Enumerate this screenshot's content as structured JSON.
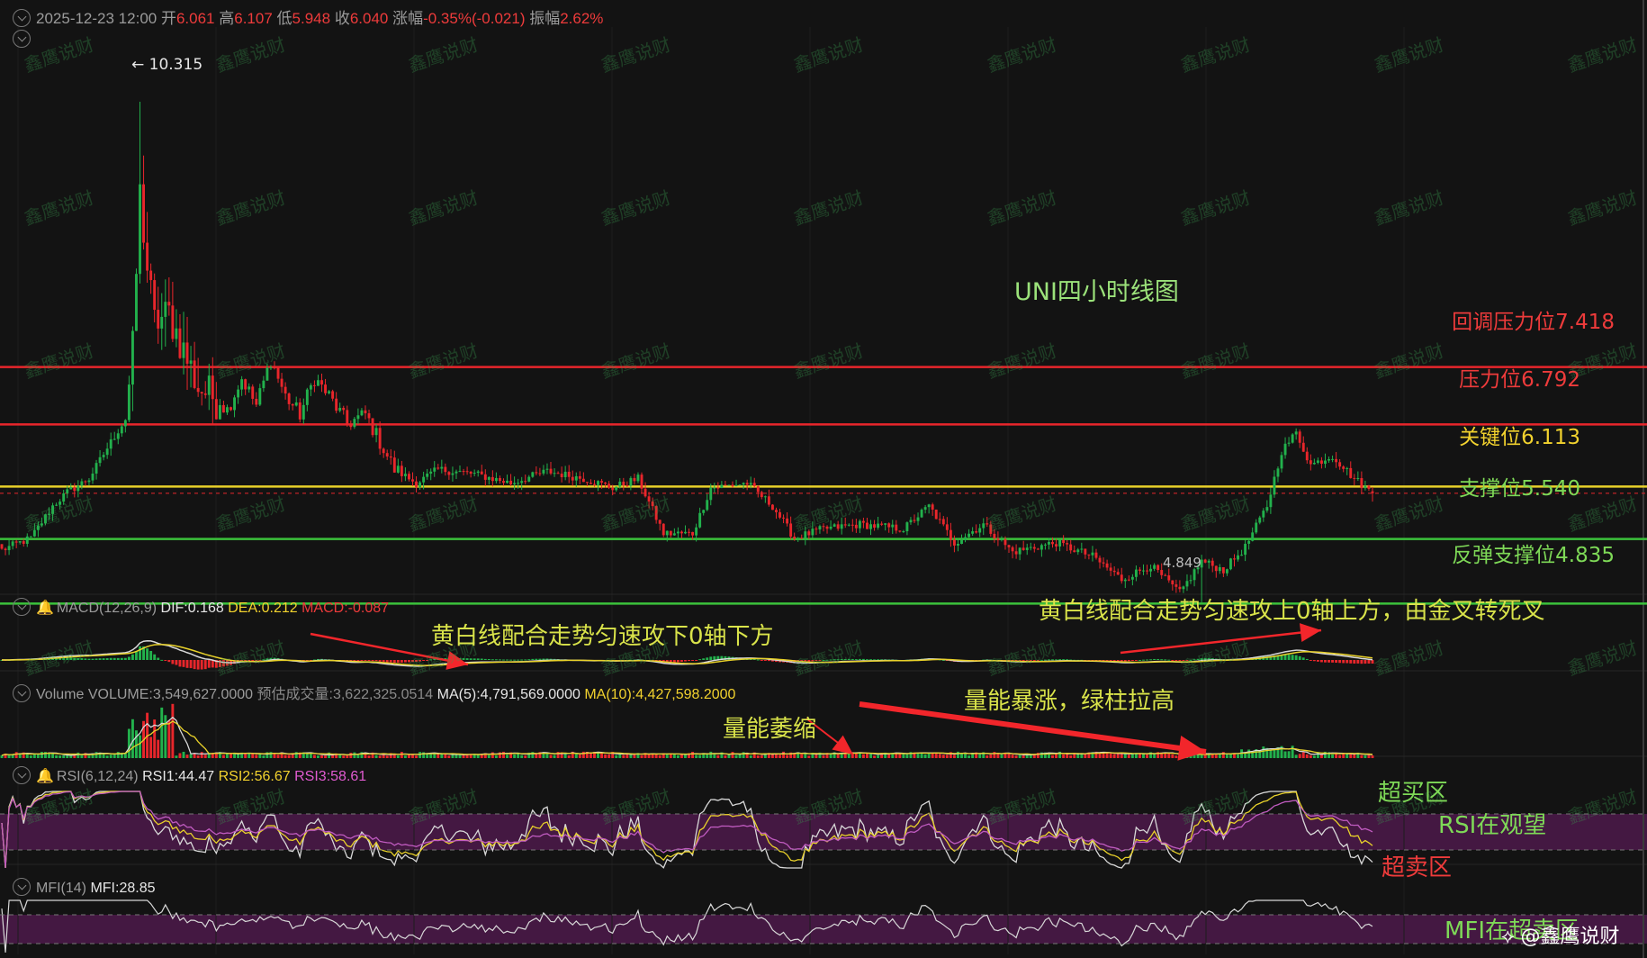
{
  "header": {
    "datetime": "2025-12-23 12:00",
    "open_label": "开",
    "open": "6.061",
    "high_label": "高",
    "high": "6.107",
    "low_label": "低",
    "low": "5.948",
    "close_label": "收",
    "close": "6.040",
    "change_label": "涨幅",
    "change": "-0.35%(-0.021)",
    "amplitude_label": "振幅",
    "amplitude": "2.62%"
  },
  "price_markers": {
    "high_marker": "← 10.315",
    "low_marker": "4.849"
  },
  "chart_title": "UNI四小时线图",
  "levels": [
    {
      "label": "回调压力位7.418",
      "value": 7.418,
      "color": "#e8262b",
      "text_color": "#ee3b3b"
    },
    {
      "label": "压力位6.792",
      "value": 6.792,
      "color": "#e8262b",
      "text_color": "#ee3b3b"
    },
    {
      "label": "关键位6.113",
      "value": 6.113,
      "color": "#e8d12a",
      "text_color": "#f2d22e"
    },
    {
      "label": "支撑位5.540",
      "value": 5.54,
      "color": "#3bc23b",
      "text_color": "#7ed957"
    },
    {
      "label": "反弹支撑位4.835",
      "value": 4.835,
      "color": "#3bc23b",
      "text_color": "#7ed957"
    }
  ],
  "macd": {
    "name": "MACD(12,26,9)",
    "dif": "DIF:0.168",
    "dea": "DEA:0.212",
    "macd": "MACD:-0.087",
    "annotation_left": "黄白线配合走势匀速攻下0轴下方",
    "annotation_right": "黄白线配合走势匀速攻上0轴上方，由金叉转死叉"
  },
  "volume": {
    "name": "Volume",
    "volume": "VOLUME:3,549,627.0000",
    "estimated": "预估成交量:3,622,325.0514",
    "ma5": "MA(5):4,791,569.0000",
    "ma10": "MA(10):4,427,598.2000",
    "annotation_shrink": "量能萎缩",
    "annotation_surge": "量能暴涨，绿柱拉高"
  },
  "rsi": {
    "name": "RSI(6,12,24)",
    "rsi1": "RSI1:44.47",
    "rsi2": "RSI2:56.67",
    "rsi3": "RSI3:58.61",
    "overbought": "超买区",
    "watch": "RSI在观望",
    "oversold": "超卖区"
  },
  "mfi": {
    "name": "MFI(14)",
    "mfi": "MFI:28.85",
    "annotation": "MFI在超卖区"
  },
  "watermark": "鑫鹰说财",
  "brand": "@鑫鹰说财",
  "chart_data": {
    "type": "candlestick",
    "title": "UNI四小时线图",
    "timeframe": "4H",
    "last_bar": {
      "time": "2025-12-23 12:00",
      "open": 6.061,
      "high": 6.107,
      "low": 5.948,
      "close": 6.04,
      "change_pct": -0.35,
      "change": -0.021,
      "amplitude_pct": 2.62
    },
    "extremes": {
      "high": 10.315,
      "low": 4.849
    },
    "horizontal_levels": [
      7.418,
      6.792,
      6.113,
      5.54,
      4.835
    ],
    "price_path_approx": [
      [
        0,
        5.42
      ],
      [
        8,
        5.55
      ],
      [
        14,
        5.9
      ],
      [
        18,
        6.05
      ],
      [
        24,
        6.2
      ],
      [
        30,
        6.6
      ],
      [
        34,
        6.85
      ],
      [
        36,
        7.6
      ],
      [
        38,
        9.3
      ],
      [
        40,
        8.5
      ],
      [
        42,
        7.9
      ],
      [
        46,
        8.0
      ],
      [
        50,
        7.6
      ],
      [
        54,
        7.2
      ],
      [
        58,
        7.1
      ],
      [
        62,
        6.95
      ],
      [
        66,
        7.3
      ],
      [
        70,
        7.0
      ],
      [
        74,
        7.5
      ],
      [
        78,
        7.1
      ],
      [
        82,
        6.9
      ],
      [
        86,
        7.3
      ],
      [
        90,
        7.1
      ],
      [
        95,
        6.8
      ],
      [
        100,
        6.9
      ],
      [
        104,
        6.6
      ],
      [
        108,
        6.3
      ],
      [
        114,
        6.15
      ],
      [
        120,
        6.3
      ],
      [
        130,
        6.25
      ],
      [
        140,
        6.15
      ],
      [
        150,
        6.28
      ],
      [
        160,
        6.2
      ],
      [
        168,
        6.1
      ],
      [
        175,
        6.2
      ],
      [
        182,
        5.6
      ],
      [
        190,
        5.6
      ],
      [
        195,
        6.1
      ],
      [
        205,
        6.15
      ],
      [
        212,
        5.9
      ],
      [
        218,
        5.55
      ],
      [
        226,
        5.65
      ],
      [
        236,
        5.7
      ],
      [
        248,
        5.65
      ],
      [
        255,
        5.9
      ],
      [
        262,
        5.5
      ],
      [
        270,
        5.7
      ],
      [
        278,
        5.4
      ],
      [
        290,
        5.5
      ],
      [
        300,
        5.35
      ],
      [
        308,
        5.1
      ],
      [
        316,
        5.25
      ],
      [
        324,
        4.95
      ],
      [
        330,
        5.3
      ],
      [
        336,
        5.2
      ],
      [
        342,
        5.45
      ],
      [
        348,
        5.9
      ],
      [
        352,
        6.5
      ],
      [
        356,
        6.7
      ],
      [
        360,
        6.35
      ],
      [
        366,
        6.45
      ],
      [
        372,
        6.2
      ],
      [
        377,
        6.04
      ]
    ],
    "indicators": {
      "MACD(12,26,9)": {
        "DIF": 0.168,
        "DEA": 0.212,
        "MACD": -0.087
      },
      "Volume": {
        "VOLUME": 3549627.0,
        "estimated": 3622325.0514,
        "MA5": 4791569.0,
        "MA10": 4427598.2
      },
      "RSI(6,12,24)": {
        "RSI1": 44.47,
        "RSI2": 56.67,
        "RSI3": 58.61
      },
      "MFI(14)": {
        "MFI": 28.85
      }
    },
    "colors": {
      "up": "#22b14c",
      "down": "#e8262b",
      "background": "#131313",
      "rsi_band": "#4a1a48",
      "yellow_line": "#e8d12a",
      "white_line": "#d8d8d8"
    }
  }
}
